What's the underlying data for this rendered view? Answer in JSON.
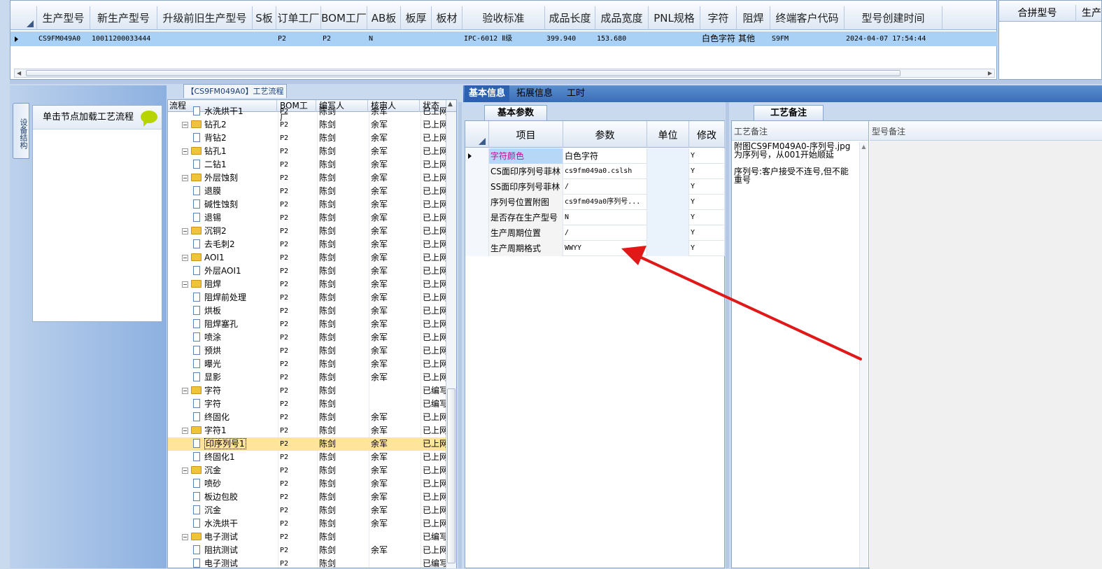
{
  "top_grid": {
    "columns": [
      "生产型号",
      "新生产型号",
      "升级前旧生产型号",
      "S板",
      "订单工厂",
      "BOM工厂",
      "AB板",
      "板厚",
      "板材",
      "验收标准",
      "成品长度",
      "成品宽度",
      "PNL规格",
      "字符",
      "阻焊",
      "终端客户代码",
      "型号创建时间"
    ],
    "row": [
      "CS9FM049A0",
      "10011200033444",
      "",
      "",
      "P2",
      "P2",
      "N",
      "",
      "",
      "IPC-6012 Ⅱ级",
      "399.940",
      "153.680",
      "",
      "白色字符",
      "其他",
      "S9FM",
      "2024-04-07 17:54:44"
    ]
  },
  "right_grid": {
    "columns": [
      "合拼型号",
      "生产"
    ]
  },
  "left_panel": {
    "side_tab": "设备结构",
    "node_hint": "单击节点加载工艺流程"
  },
  "process": {
    "title": "【CS9FM049A0】工艺流程",
    "columns": [
      "流程",
      "BOM工厂",
      "编写人",
      "核审人",
      "状态"
    ],
    "rows": [
      {
        "level": 2,
        "name": "水洗烘干1",
        "bom": "P2",
        "writer": "陈剑",
        "reviewer": "余军",
        "status": "已上网"
      },
      {
        "level": 1,
        "name": "钻孔2",
        "bom": "P2",
        "writer": "陈剑",
        "reviewer": "余军",
        "status": "已上网"
      },
      {
        "level": 2,
        "name": "背钻2",
        "bom": "P2",
        "writer": "陈剑",
        "reviewer": "余军",
        "status": "已上网"
      },
      {
        "level": 1,
        "name": "钻孔1",
        "bom": "P2",
        "writer": "陈剑",
        "reviewer": "余军",
        "status": "已上网"
      },
      {
        "level": 2,
        "name": "二钻1",
        "bom": "P2",
        "writer": "陈剑",
        "reviewer": "余军",
        "status": "已上网"
      },
      {
        "level": 1,
        "name": "外层蚀刻",
        "bom": "P2",
        "writer": "陈剑",
        "reviewer": "余军",
        "status": "已上网"
      },
      {
        "level": 2,
        "name": "退膜",
        "bom": "P2",
        "writer": "陈剑",
        "reviewer": "余军",
        "status": "已上网"
      },
      {
        "level": 2,
        "name": "碱性蚀刻",
        "bom": "P2",
        "writer": "陈剑",
        "reviewer": "余军",
        "status": "已上网"
      },
      {
        "level": 2,
        "name": "退锡",
        "bom": "P2",
        "writer": "陈剑",
        "reviewer": "余军",
        "status": "已上网"
      },
      {
        "level": 1,
        "name": "沉铜2",
        "bom": "P2",
        "writer": "陈剑",
        "reviewer": "余军",
        "status": "已上网"
      },
      {
        "level": 2,
        "name": "去毛刺2",
        "bom": "P2",
        "writer": "陈剑",
        "reviewer": "余军",
        "status": "已上网"
      },
      {
        "level": 1,
        "name": "AOI1",
        "bom": "P2",
        "writer": "陈剑",
        "reviewer": "余军",
        "status": "已上网"
      },
      {
        "level": 2,
        "name": "外层AOI1",
        "bom": "P2",
        "writer": "陈剑",
        "reviewer": "余军",
        "status": "已上网"
      },
      {
        "level": 1,
        "name": "阻焊",
        "bom": "P2",
        "writer": "陈剑",
        "reviewer": "余军",
        "status": "已上网"
      },
      {
        "level": 2,
        "name": "阻焊前处理",
        "bom": "P2",
        "writer": "陈剑",
        "reviewer": "余军",
        "status": "已上网"
      },
      {
        "level": 2,
        "name": "烘板",
        "bom": "P2",
        "writer": "陈剑",
        "reviewer": "余军",
        "status": "已上网"
      },
      {
        "level": 2,
        "name": "阻焊塞孔",
        "bom": "P2",
        "writer": "陈剑",
        "reviewer": "余军",
        "status": "已上网"
      },
      {
        "level": 2,
        "name": "喷涂",
        "bom": "P2",
        "writer": "陈剑",
        "reviewer": "余军",
        "status": "已上网"
      },
      {
        "level": 2,
        "name": "预烘",
        "bom": "P2",
        "writer": "陈剑",
        "reviewer": "余军",
        "status": "已上网"
      },
      {
        "level": 2,
        "name": "曝光",
        "bom": "P2",
        "writer": "陈剑",
        "reviewer": "余军",
        "status": "已上网"
      },
      {
        "level": 2,
        "name": "显影",
        "bom": "P2",
        "writer": "陈剑",
        "reviewer": "余军",
        "status": "已上网"
      },
      {
        "level": 1,
        "name": "字符",
        "bom": "P2",
        "writer": "陈剑",
        "reviewer": "",
        "status": "已编写"
      },
      {
        "level": 2,
        "name": "字符",
        "bom": "P2",
        "writer": "陈剑",
        "reviewer": "",
        "status": "已编写"
      },
      {
        "level": 2,
        "name": "终固化",
        "bom": "P2",
        "writer": "陈剑",
        "reviewer": "余军",
        "status": "已上网"
      },
      {
        "level": 1,
        "name": "字符1",
        "bom": "P2",
        "writer": "陈剑",
        "reviewer": "余军",
        "status": "已上网"
      },
      {
        "level": 2,
        "name": "印序列号1",
        "bom": "P2",
        "writer": "陈剑",
        "reviewer": "余军",
        "status": "已上网",
        "selected": true
      },
      {
        "level": 2,
        "name": "终固化1",
        "bom": "P2",
        "writer": "陈剑",
        "reviewer": "余军",
        "status": "已上网"
      },
      {
        "level": 1,
        "name": "沉金",
        "bom": "P2",
        "writer": "陈剑",
        "reviewer": "余军",
        "status": "已上网"
      },
      {
        "level": 2,
        "name": "喷砂",
        "bom": "P2",
        "writer": "陈剑",
        "reviewer": "余军",
        "status": "已上网"
      },
      {
        "level": 2,
        "name": "板边包胶",
        "bom": "P2",
        "writer": "陈剑",
        "reviewer": "余军",
        "status": "已上网"
      },
      {
        "level": 2,
        "name": "沉金",
        "bom": "P2",
        "writer": "陈剑",
        "reviewer": "余军",
        "status": "已上网"
      },
      {
        "level": 2,
        "name": "水洗烘干",
        "bom": "P2",
        "writer": "陈剑",
        "reviewer": "余军",
        "status": "已上网"
      },
      {
        "level": 1,
        "name": "电子测试",
        "bom": "P2",
        "writer": "陈剑",
        "reviewer": "",
        "status": "已编写"
      },
      {
        "level": 2,
        "name": "阻抗测试",
        "bom": "P2",
        "writer": "陈剑",
        "reviewer": "余军",
        "status": "已上网"
      },
      {
        "level": 2,
        "name": "电子测试",
        "bom": "P2",
        "writer": "陈剑",
        "reviewer": "",
        "status": "已编写"
      }
    ]
  },
  "tabs": [
    "基本信息",
    "拓展信息",
    "工时"
  ],
  "basic_params": {
    "title": "基本参数",
    "columns": [
      "项目",
      "参数",
      "单位",
      "修改"
    ],
    "rows": [
      {
        "item": "字符颜色",
        "param": "白色字符",
        "unit": "",
        "modify": "Y",
        "current": true
      },
      {
        "item": "CS面印序列号菲林",
        "param": "cs9fm049a0.cslsh",
        "unit": "",
        "modify": "Y"
      },
      {
        "item": "SS面印序列号菲林",
        "param": "/",
        "unit": "",
        "modify": "Y"
      },
      {
        "item": "序列号位置附图",
        "param": "cs9fm049a0序列号...",
        "unit": "",
        "modify": "Y"
      },
      {
        "item": "是否存在生产型号",
        "param": "N",
        "unit": "",
        "modify": "Y"
      },
      {
        "item": "生产周期位置",
        "param": "/",
        "unit": "",
        "modify": "Y"
      },
      {
        "item": "生产周期格式",
        "param": "WWYY",
        "unit": "",
        "modify": "Y"
      }
    ]
  },
  "remarks": {
    "title": "工艺备注",
    "process_header": "工艺备注",
    "model_header": "型号备注",
    "process_text": "附图CS9FM049A0-序列号.jpg为序列号，从001开始顺延\n\n序列号:客户接受不连号,但不能重号",
    "model_text": ""
  },
  "colors": {
    "accent": "#2b61b0",
    "selection": "#ffe49b",
    "row_highlight": "#a9d1f5",
    "arrow": "#e01818"
  }
}
